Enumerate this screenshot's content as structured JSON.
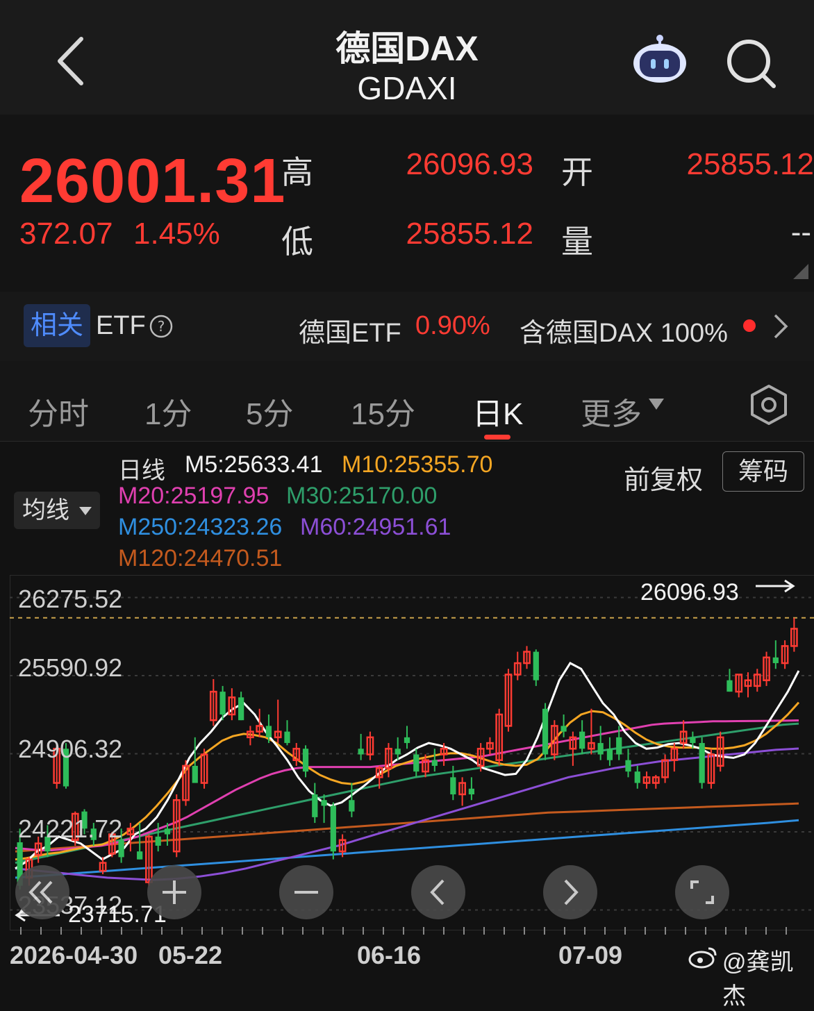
{
  "header": {
    "title": "德国DAX",
    "subtitle": "GDAXI"
  },
  "quote": {
    "price": "26001.31",
    "change": "372.07",
    "change_pct": "1.45%",
    "high_label": "高",
    "high": "26096.93",
    "open_label": "开",
    "open": "25855.12",
    "low_label": "低",
    "low": "25855.12",
    "volume_label": "量",
    "volume": "--"
  },
  "etf": {
    "tag": "相关",
    "label": "ETF",
    "help_icon": "question-circle-icon",
    "item_name": "德国ETF",
    "item_pct": "0.90%",
    "contains": "含德国DAX 100%"
  },
  "tabs": [
    "分时",
    "1分",
    "5分",
    "15分",
    "日K",
    "更多"
  ],
  "active_tab": "日K",
  "indicators": {
    "period": "日线",
    "m5": "M5:25633.41",
    "m10": "M10:25355.70",
    "m20": "M20:25197.95",
    "m30": "M30:25170.00",
    "m250": "M250:24323.26",
    "m60": "M60:24951.61",
    "m120": "M120:24470.51",
    "average_button": "均线",
    "adjust_label": "前复权",
    "chip_button": "筹码"
  },
  "colors": {
    "up": "#ff3b33",
    "down": "#2ebd5a",
    "m5": "#ffffff",
    "m10": "#f5a623",
    "m20": "#e040b0",
    "m30": "#2e9e6a",
    "m60": "#8c4fd6",
    "m120": "#c45a1e",
    "m250": "#2f8fe0"
  },
  "chart_data": {
    "type": "candlestick",
    "y_ticks": [
      "26275.52",
      "25590.92",
      "24906.32",
      "24221.72",
      "23537.12"
    ],
    "ylim": [
      23400,
      26400
    ],
    "max_label": "26096.93",
    "min_label": "23715.71",
    "x_ticks": [
      "2026-04-30",
      "05-22",
      "06-16",
      "07-09"
    ],
    "dashed_line_value": 26096.93,
    "candles": [
      {
        "o": 24130,
        "h": 24250,
        "l": 23715.71,
        "c": 23750
      },
      {
        "o": 23820,
        "h": 24000,
        "l": 23750,
        "c": 23980
      },
      {
        "o": 24020,
        "h": 24180,
        "l": 23950,
        "c": 24120
      },
      {
        "o": 24180,
        "h": 24280,
        "l": 24000,
        "c": 24050
      },
      {
        "o": 24650,
        "h": 25000,
        "l": 24600,
        "c": 24950
      },
      {
        "o": 24950,
        "h": 25000,
        "l": 24600,
        "c": 24620
      },
      {
        "o": 24150,
        "h": 24400,
        "l": 24100,
        "c": 24380
      },
      {
        "o": 24400,
        "h": 24420,
        "l": 24200,
        "c": 24250
      },
      {
        "o": 24250,
        "h": 24300,
        "l": 24100,
        "c": 24150
      },
      {
        "o": 23880,
        "h": 24000,
        "l": 23850,
        "c": 23950
      },
      {
        "o": 24030,
        "h": 24220,
        "l": 24000,
        "c": 24200
      },
      {
        "o": 24150,
        "h": 24250,
        "l": 23950,
        "c": 24000
      },
      {
        "o": 24200,
        "h": 24300,
        "l": 24050,
        "c": 24250
      },
      {
        "o": 24050,
        "h": 24300,
        "l": 23980,
        "c": 23980
      },
      {
        "o": 23780,
        "h": 24200,
        "l": 23750,
        "c": 24180
      },
      {
        "o": 24180,
        "h": 24300,
        "l": 24050,
        "c": 24100
      },
      {
        "o": 24250,
        "h": 24300,
        "l": 24100,
        "c": 24200
      },
      {
        "o": 24050,
        "h": 24550,
        "l": 24000,
        "c": 24500
      },
      {
        "o": 24500,
        "h": 24850,
        "l": 24450,
        "c": 24800
      },
      {
        "o": 24800,
        "h": 25050,
        "l": 24750,
        "c": 24650
      },
      {
        "o": 24650,
        "h": 24950,
        "l": 24600,
        "c": 24900
      },
      {
        "o": 25200,
        "h": 25560,
        "l": 25150,
        "c": 25450
      },
      {
        "o": 25450,
        "h": 25500,
        "l": 25200,
        "c": 25250
      },
      {
        "o": 25250,
        "h": 25480,
        "l": 25200,
        "c": 25400
      },
      {
        "o": 25400,
        "h": 25450,
        "l": 25200,
        "c": 25200
      },
      {
        "o": 25050,
        "h": 25150,
        "l": 24980,
        "c": 25100
      },
      {
        "o": 25100,
        "h": 25300,
        "l": 25050,
        "c": 25150
      },
      {
        "o": 25150,
        "h": 25250,
        "l": 25000,
        "c": 25050
      },
      {
        "o": 25050,
        "h": 25380,
        "l": 25000,
        "c": 25100
      },
      {
        "o": 25100,
        "h": 25200,
        "l": 24980,
        "c": 25000
      },
      {
        "o": 24850,
        "h": 25000,
        "l": 24800,
        "c": 24950
      },
      {
        "o": 24950,
        "h": 24980,
        "l": 24700,
        "c": 24750
      },
      {
        "o": 24550,
        "h": 24650,
        "l": 24300,
        "c": 24350
      },
      {
        "o": 24500,
        "h": 24550,
        "l": 24300,
        "c": 24450
      },
      {
        "o": 24450,
        "h": 24480,
        "l": 23980,
        "c": 24050
      },
      {
        "o": 24050,
        "h": 24200,
        "l": 24000,
        "c": 24150
      },
      {
        "o": 24500,
        "h": 24650,
        "l": 24350,
        "c": 24400
      },
      {
        "o": 24950,
        "h": 25080,
        "l": 24850,
        "c": 24900
      },
      {
        "o": 24900,
        "h": 25100,
        "l": 24850,
        "c": 25050
      },
      {
        "o": 24700,
        "h": 24800,
        "l": 24600,
        "c": 24780
      },
      {
        "o": 24780,
        "h": 25000,
        "l": 24700,
        "c": 24950
      },
      {
        "o": 24950,
        "h": 25050,
        "l": 24850,
        "c": 24900
      },
      {
        "o": 25050,
        "h": 25150,
        "l": 24950,
        "c": 25000
      },
      {
        "o": 24900,
        "h": 24950,
        "l": 24700,
        "c": 24750
      },
      {
        "o": 24750,
        "h": 24900,
        "l": 24700,
        "c": 24850
      },
      {
        "o": 24850,
        "h": 24950,
        "l": 24750,
        "c": 24800
      },
      {
        "o": 24900,
        "h": 25000,
        "l": 24800,
        "c": 24950
      },
      {
        "o": 24700,
        "h": 24800,
        "l": 24500,
        "c": 24550
      },
      {
        "o": 24550,
        "h": 24700,
        "l": 24450,
        "c": 24650
      },
      {
        "o": 24600,
        "h": 24700,
        "l": 24500,
        "c": 24550
      },
      {
        "o": 24800,
        "h": 25000,
        "l": 24750,
        "c": 24950
      },
      {
        "o": 24950,
        "h": 25050,
        "l": 24900,
        "c": 25000
      },
      {
        "o": 24850,
        "h": 25300,
        "l": 24800,
        "c": 25250
      },
      {
        "o": 25150,
        "h": 25650,
        "l": 25100,
        "c": 25600
      },
      {
        "o": 25600,
        "h": 25800,
        "l": 25550,
        "c": 25700
      },
      {
        "o": 25700,
        "h": 25850,
        "l": 25650,
        "c": 25800
      },
      {
        "o": 25800,
        "h": 25820,
        "l": 25500,
        "c": 25550
      },
      {
        "o": 25300,
        "h": 25350,
        "l": 24850,
        "c": 24900
      },
      {
        "o": 24900,
        "h": 25200,
        "l": 24850,
        "c": 25150
      },
      {
        "o": 25150,
        "h": 25250,
        "l": 25050,
        "c": 25100
      },
      {
        "o": 24950,
        "h": 25100,
        "l": 24800,
        "c": 25050
      },
      {
        "o": 25100,
        "h": 25200,
        "l": 24900,
        "c": 24950
      },
      {
        "o": 24950,
        "h": 25300,
        "l": 24900,
        "c": 25000
      },
      {
        "o": 25000,
        "h": 25150,
        "l": 24850,
        "c": 24900
      },
      {
        "o": 24950,
        "h": 25050,
        "l": 24800,
        "c": 24850
      },
      {
        "o": 25050,
        "h": 25150,
        "l": 24850,
        "c": 24900
      },
      {
        "o": 24850,
        "h": 24950,
        "l": 24700,
        "c": 24750
      },
      {
        "o": 24750,
        "h": 24800,
        "l": 24600,
        "c": 24650
      },
      {
        "o": 24650,
        "h": 24750,
        "l": 24600,
        "c": 24700
      },
      {
        "o": 24650,
        "h": 24720,
        "l": 24600,
        "c": 24700
      },
      {
        "o": 24700,
        "h": 24900,
        "l": 24650,
        "c": 24850
      },
      {
        "o": 24850,
        "h": 25000,
        "l": 24750,
        "c": 24950
      },
      {
        "o": 25000,
        "h": 25200,
        "l": 24950,
        "c": 25100
      },
      {
        "o": 25050,
        "h": 25100,
        "l": 24950,
        "c": 25000
      },
      {
        "o": 25000,
        "h": 25050,
        "l": 24600,
        "c": 24650
      },
      {
        "o": 24650,
        "h": 24950,
        "l": 24600,
        "c": 24900
      },
      {
        "o": 24800,
        "h": 25100,
        "l": 24750,
        "c": 25050
      },
      {
        "o": 25550,
        "h": 25650,
        "l": 25450,
        "c": 25450
      },
      {
        "o": 25450,
        "h": 25600,
        "l": 25400,
        "c": 25600
      },
      {
        "o": 25500,
        "h": 25620,
        "l": 25400,
        "c": 25550
      },
      {
        "o": 25500,
        "h": 25650,
        "l": 25450,
        "c": 25600
      },
      {
        "o": 25550,
        "h": 25800,
        "l": 25500,
        "c": 25750
      },
      {
        "o": 25750,
        "h": 25900,
        "l": 25650,
        "c": 25700
      },
      {
        "o": 25700,
        "h": 25900,
        "l": 25650,
        "c": 25850
      },
      {
        "o": 25850,
        "h": 26096.93,
        "l": 25800,
        "c": 26001.31
      }
    ],
    "series": [
      {
        "name": "M5",
        "y": [
          23900,
          23960,
          24050,
          24100,
          24180,
          24150,
          24120,
          24050,
          23980,
          24030,
          24080,
          24200,
          24250,
          24350,
          24500,
          24680,
          24870,
          25000,
          25100,
          25220,
          25300,
          25350,
          25250,
          25100,
          24980,
          24850,
          24700,
          24580,
          24500,
          24450,
          24480,
          24550,
          24620,
          24700,
          24780,
          24850,
          24900,
          24960,
          25000,
          24980,
          24950,
          24900,
          24850,
          24780,
          24750,
          24720,
          24730,
          24850,
          25050,
          25300,
          25550,
          25700,
          25650,
          25500,
          25350,
          25250,
          25100,
          25000,
          24950,
          24960,
          24990,
          25000,
          24980,
          24950,
          24900,
          24880,
          24870,
          24900,
          25000,
          25150,
          25300,
          25450,
          25633.41
        ]
      },
      {
        "name": "M10",
        "y": [
          23980,
          23990,
          24010,
          24030,
          24040,
          24060,
          24080,
          24100,
          24110,
          24150,
          24200,
          24270,
          24350,
          24450,
          24560,
          24680,
          24800,
          24880,
          24950,
          25020,
          25060,
          25080,
          25070,
          25050,
          25000,
          24920,
          24850,
          24780,
          24720,
          24680,
          24650,
          24640,
          24660,
          24700,
          24750,
          24800,
          24830,
          24860,
          24880,
          24900,
          24910,
          24910,
          24890,
          24860,
          24830,
          24810,
          24800,
          24810,
          24860,
          24960,
          25080,
          25180,
          25250,
          25280,
          25270,
          25220,
          25160,
          25090,
          25030,
          24990,
          24970,
          24960,
          24960,
          24960,
          24950,
          24950,
          24960,
          24980,
          25020,
          25080,
          25160,
          25250,
          25355.7
        ]
      },
      {
        "name": "M20",
        "y": [
          24080,
          24070,
          24060,
          24060,
          24070,
          24080,
          24090,
          24100,
          24120,
          24150,
          24180,
          24220,
          24260,
          24300,
          24350,
          24410,
          24470,
          24530,
          24590,
          24640,
          24690,
          24730,
          24760,
          24780,
          24790,
          24790,
          24790,
          24790,
          24790,
          24790,
          24800,
          24810,
          24820,
          24830,
          24840,
          24850,
          24860,
          24870,
          24880,
          24900,
          24920,
          24940,
          24960,
          24980,
          25000,
          25020,
          25040,
          25060,
          25080,
          25100,
          25120,
          25140,
          25160,
          25170,
          25175,
          25180,
          25185,
          25190,
          25190,
          25192,
          25193,
          25194,
          25195,
          25196,
          25197.95
        ]
      },
      {
        "name": "M30",
        "y": [
          23950,
          23980,
          24010,
          24040,
          24070,
          24100,
          24130,
          24160,
          24190,
          24220,
          24250,
          24280,
          24310,
          24340,
          24370,
          24400,
          24430,
          24460,
          24490,
          24520,
          24550,
          24580,
          24610,
          24640,
          24670,
          24700,
          24720,
          24740,
          24760,
          24780,
          24800,
          24820,
          24840,
          24860,
          24880,
          24900,
          24920,
          24940,
          24960,
          24980,
          25000,
          25020,
          25040,
          25060,
          25080,
          25100,
          25120,
          25140,
          25160,
          25170
        ]
      },
      {
        "name": "M60",
        "y": [
          23900,
          23880,
          23860,
          23840,
          23820,
          23810,
          23800,
          23810,
          23830,
          23860,
          23900,
          23950,
          24000,
          24050,
          24100,
          24160,
          24220,
          24280,
          24340,
          24400,
          24460,
          24520,
          24580,
          24640,
          24700,
          24740,
          24780,
          24810,
          24840,
          24860,
          24880,
          24900,
          24920,
          24940,
          24951.61
        ]
      },
      {
        "name": "M120",
        "y": [
          24050,
          24070,
          24090,
          24110,
          24130,
          24150,
          24170,
          24190,
          24210,
          24230,
          24250,
          24270,
          24290,
          24310,
          24330,
          24350,
          24370,
          24390,
          24400,
          24410,
          24420,
          24430,
          24440,
          24450,
          24460,
          24470.51
        ]
      },
      {
        "name": "M250",
        "y": [
          23820,
          23840,
          23860,
          23880,
          23900,
          23920,
          23940,
          23960,
          23980,
          24000,
          24020,
          24040,
          24060,
          24080,
          24100,
          24120,
          24140,
          24160,
          24180,
          24200,
          24220,
          24240,
          24260,
          24280,
          24300,
          24323.26
        ]
      }
    ]
  },
  "controls": [
    "double-chevron-left-icon",
    "plus-icon",
    "minus-icon",
    "chevron-left-icon",
    "chevron-right-icon",
    "fullscreen-icon"
  ],
  "watermark": "@龚凯杰"
}
